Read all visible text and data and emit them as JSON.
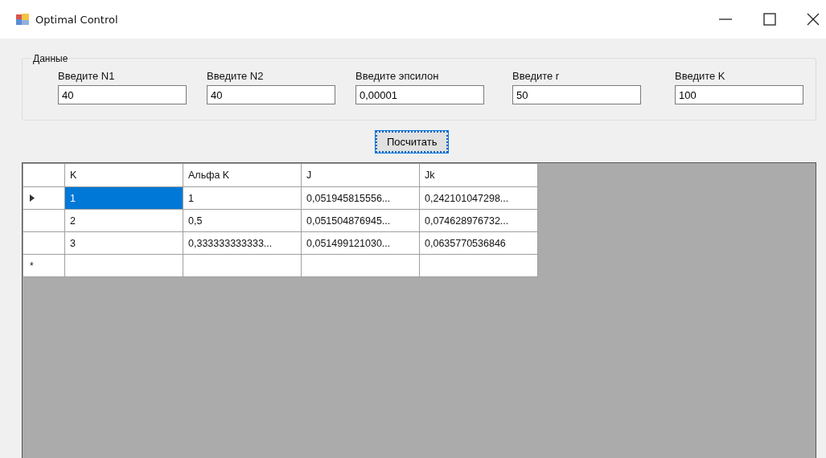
{
  "window": {
    "title": "Optimal Control"
  },
  "group": {
    "title": "Данные",
    "fields": [
      {
        "label": "Введите N1",
        "value": "40"
      },
      {
        "label": "Введите N2",
        "value": "40"
      },
      {
        "label": "Введите эпсилон",
        "value": "0,00001"
      },
      {
        "label": "Введите r",
        "value": "50"
      },
      {
        "label": "Введите K",
        "value": "100"
      }
    ]
  },
  "button": {
    "label": "Посчитать"
  },
  "table": {
    "columns": [
      "K",
      "Альфа K",
      "J",
      "Jk"
    ],
    "rows": [
      {
        "kind": "current",
        "cells": [
          {
            "text": "1",
            "selected": true
          },
          {
            "text": "1",
            "selected": false
          },
          {
            "text": "0,051945815556...",
            "selected": false
          },
          {
            "text": "0,242101047298...",
            "selected": false
          }
        ]
      },
      {
        "kind": "data",
        "cells": [
          {
            "text": "2",
            "selected": false
          },
          {
            "text": "0,5",
            "selected": false
          },
          {
            "text": "0,051504876945...",
            "selected": false
          },
          {
            "text": "0,074628976732...",
            "selected": false
          }
        ]
      },
      {
        "kind": "data",
        "cells": [
          {
            "text": "3",
            "selected": false
          },
          {
            "text": "0,333333333333...",
            "selected": false
          },
          {
            "text": "0,051499121030...",
            "selected": false
          },
          {
            "text": "0,0635770536846",
            "selected": false
          }
        ]
      },
      {
        "kind": "new",
        "marker": "*",
        "cells": [
          {
            "selected": false
          },
          {
            "selected": false
          },
          {
            "selected": false
          },
          {
            "selected": false
          }
        ]
      }
    ]
  }
}
